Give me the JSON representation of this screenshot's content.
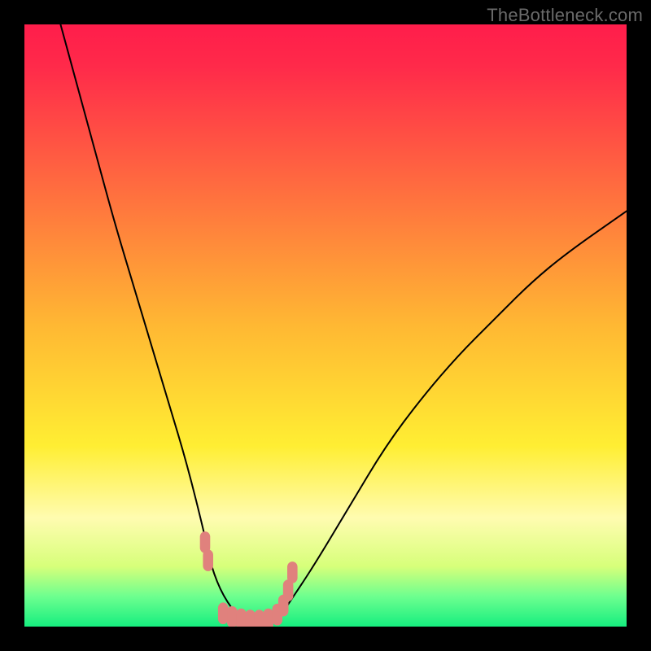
{
  "watermark": "TheBottleneck.com",
  "colors": {
    "frame": "#000000",
    "red_top": "#ff1d4b",
    "orange": "#ffa335",
    "yellow": "#ffee33",
    "pale_yellow": "#fffcb0",
    "green": "#16ee7f",
    "curve": "#000000",
    "marker": "#e0817d"
  },
  "chart_data": {
    "type": "line",
    "title": "",
    "xlabel": "",
    "ylabel": "",
    "xlim": [
      0,
      100
    ],
    "ylim": [
      0,
      100
    ],
    "series": [
      {
        "name": "bottleneck-curve",
        "x": [
          6,
          9,
          12,
          15,
          18,
          21,
          24,
          27,
          30,
          31,
          33,
          36,
          39,
          42,
          44,
          48,
          54,
          60,
          66,
          72,
          78,
          84,
          90,
          100
        ],
        "y": [
          100,
          89,
          78,
          67,
          57,
          47,
          37,
          27,
          15,
          10,
          5,
          1,
          0.5,
          1,
          4,
          10,
          20,
          30,
          38,
          45,
          51,
          57,
          62,
          69
        ]
      }
    ],
    "markers": {
      "name": "highlighted-points",
      "x": [
        30,
        30.5,
        33,
        34.5,
        36,
        37.5,
        39,
        40.5,
        42,
        43,
        43.8,
        44.5
      ],
      "y": [
        14,
        11,
        2.2,
        1.6,
        1.2,
        1.0,
        1.0,
        1.2,
        2.0,
        3.5,
        6.0,
        9.0
      ]
    },
    "gradient_stops": [
      {
        "pos": 0.0,
        "color": "#ff1d4b"
      },
      {
        "pos": 0.07,
        "color": "#ff2a4a"
      },
      {
        "pos": 0.5,
        "color": "#ffb833"
      },
      {
        "pos": 0.7,
        "color": "#ffee33"
      },
      {
        "pos": 0.82,
        "color": "#fffcb0"
      },
      {
        "pos": 0.9,
        "color": "#d7ff7a"
      },
      {
        "pos": 0.95,
        "color": "#6dff8f"
      },
      {
        "pos": 1.0,
        "color": "#16ee7f"
      }
    ]
  }
}
